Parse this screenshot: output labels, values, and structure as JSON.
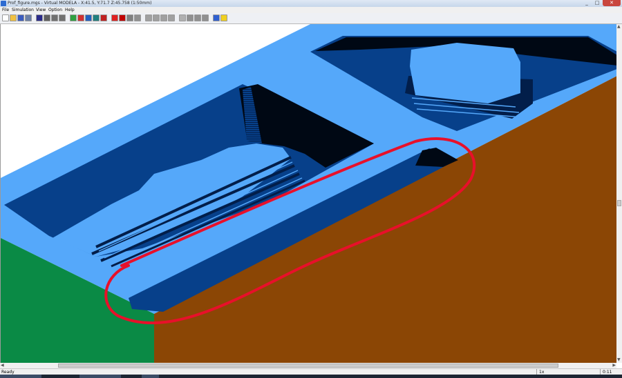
{
  "window": {
    "title": "Prof_figure.mgs - Virtual MODELA - X:41.5, Y:71.7 Z:45.758 (1:50mm)",
    "controls": [
      "_",
      "□",
      "✕"
    ]
  },
  "menu": [
    {
      "label": "File"
    },
    {
      "label": "Simulation"
    },
    {
      "label": "View"
    },
    {
      "label": "Option"
    },
    {
      "label": "Help"
    }
  ],
  "toolbar": {
    "buttons": [
      {
        "icon": "new-file-icon",
        "color": "#ffffff"
      },
      {
        "icon": "open-file-icon",
        "color": "#f0c040"
      },
      {
        "icon": "save-icon",
        "color": "#3a5bbf"
      },
      {
        "icon": "print-icon",
        "color": "#6a7fa8"
      },
      {
        "icon": "simulation-start-icon",
        "color": "#2a2a8a"
      },
      {
        "icon": "simulation-stop-icon",
        "color": "#606060"
      },
      {
        "icon": "step-icon",
        "color": "#707070"
      },
      {
        "icon": "end-icon",
        "color": "#707070"
      },
      {
        "icon": "toolpath-icon",
        "color": "#30a040"
      },
      {
        "icon": "material-icon",
        "color": "#d03030"
      },
      {
        "icon": "tool-icon",
        "color": "#2060c0"
      },
      {
        "icon": "cut-icon",
        "color": "#208080"
      },
      {
        "icon": "3d-icon",
        "color": "#c02020"
      },
      {
        "icon": "render-red-icon",
        "color": "#e02020"
      },
      {
        "icon": "render-color-icon",
        "color": "#c00000"
      },
      {
        "icon": "shade-icon",
        "color": "#808080"
      },
      {
        "icon": "shade2-icon",
        "color": "#909090"
      },
      {
        "icon": "view-front-icon",
        "color": "#a0a0a0"
      },
      {
        "icon": "view-right-icon",
        "color": "#a0a0a0"
      },
      {
        "icon": "view-top-icon",
        "color": "#a0a0a0"
      },
      {
        "icon": "view-iso-icon",
        "color": "#a0a0a0"
      },
      {
        "icon": "zoom-in-icon",
        "color": "#b0b0b0"
      },
      {
        "icon": "zoom-out-icon",
        "color": "#909090"
      },
      {
        "icon": "rotate-icon",
        "color": "#909090"
      },
      {
        "icon": "fit-icon",
        "color": "#909090"
      },
      {
        "icon": "color-palette-icon",
        "color": "#3060d0"
      },
      {
        "icon": "light-icon",
        "color": "#f0d020"
      }
    ]
  },
  "viewport": {
    "colors": {
      "top_face": "#55a8fa",
      "pocket": "#07408a",
      "pocket_dark": "#021e4a",
      "shadow": "#000814",
      "front_face": "#8b4605",
      "left_face": "#0a8a45",
      "annotation": "#e8102a"
    }
  },
  "status": {
    "left": "Ready",
    "field_1": "1x",
    "field_2": "0:11"
  }
}
